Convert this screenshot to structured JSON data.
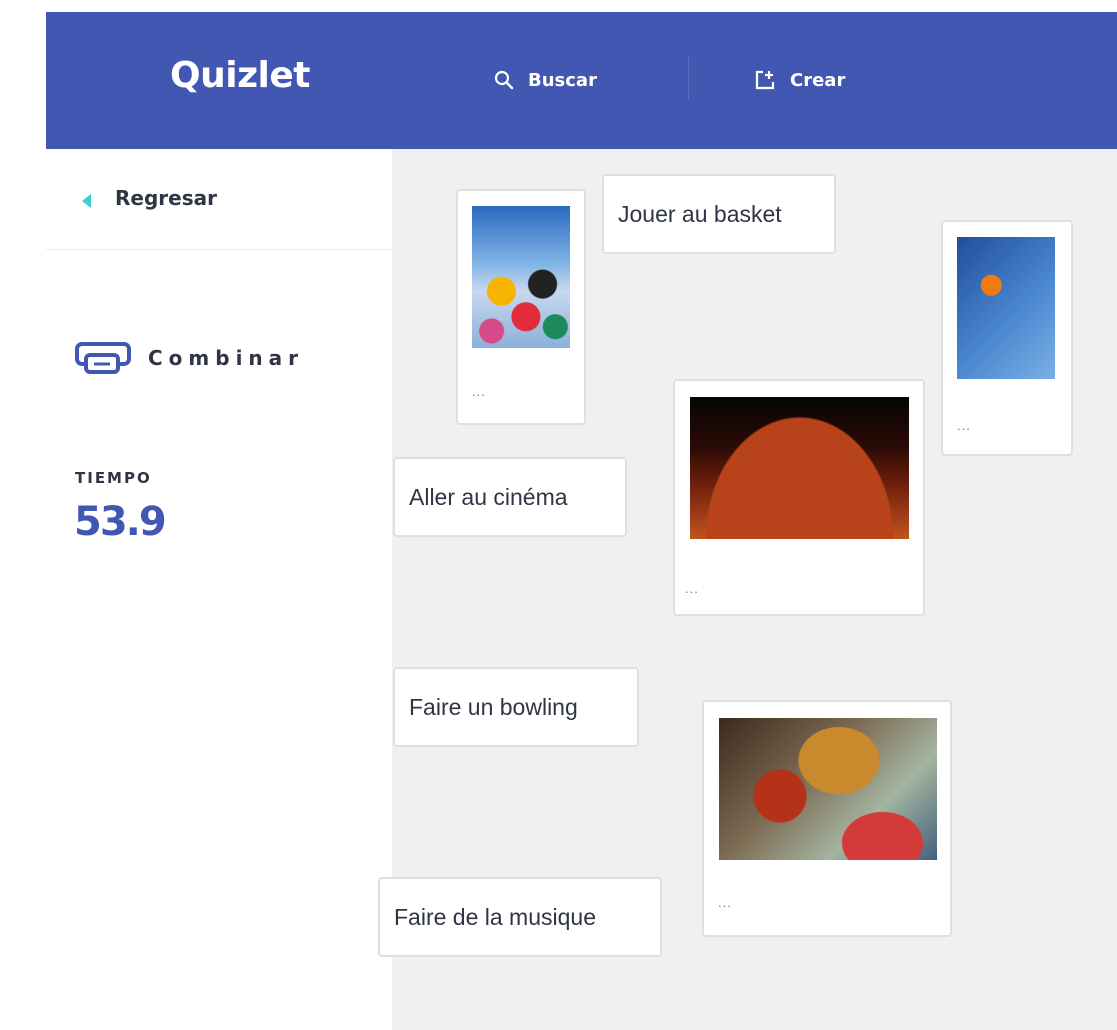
{
  "header": {
    "logo": "Quizlet",
    "search_label": "Buscar",
    "create_label": "Crear"
  },
  "sidebar": {
    "back_label": "Regresar",
    "mode_label": "Combinar",
    "time_label": "TIEMPO",
    "time_value": "53.9"
  },
  "board": {
    "text_cards": [
      {
        "label": "Jouer au basket"
      },
      {
        "label": "Aller au cinéma"
      },
      {
        "label": "Faire un bowling"
      },
      {
        "label": "Faire de la musique"
      }
    ],
    "image_cards": [
      {
        "image": "bowling-balls",
        "caption": "..."
      },
      {
        "image": "basketball-hoop",
        "caption": "..."
      },
      {
        "image": "cinema-audience",
        "caption": "..."
      },
      {
        "image": "music-band",
        "caption": "..."
      }
    ]
  },
  "colors": {
    "brand": "#4257b2",
    "accent": "#3ccfcf",
    "board_bg": "#f0f0f0"
  }
}
